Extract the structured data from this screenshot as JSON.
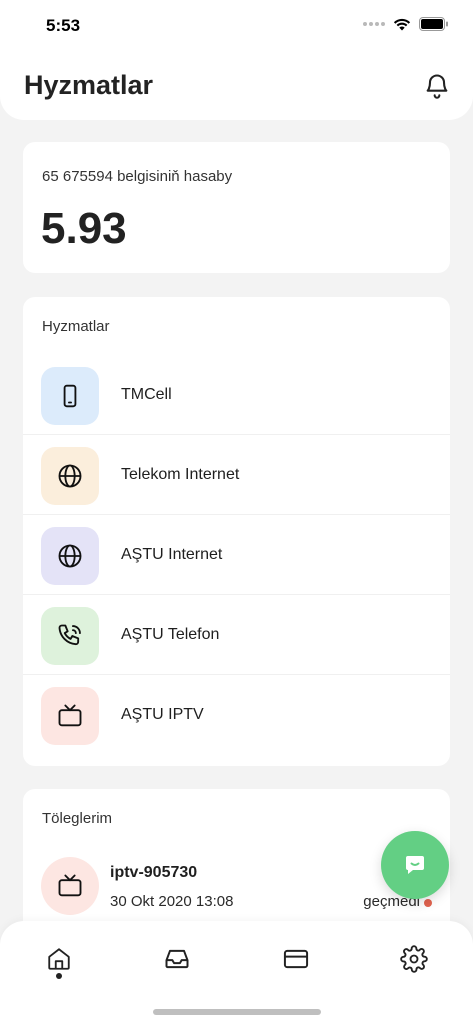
{
  "status_bar": {
    "time": "5:53"
  },
  "header": {
    "title": "Hyzmatlar",
    "bell_icon": "bell-icon"
  },
  "balance": {
    "label": "65 675594 belgisiniň hasaby",
    "value": "5.93"
  },
  "services": {
    "title": "Hyzmatlar",
    "items": [
      {
        "label": "TMCell",
        "icon": "phone-icon",
        "color": "#dcebfb"
      },
      {
        "label": "Telekom Internet",
        "icon": "globe-icon",
        "color": "#fbeedc"
      },
      {
        "label": "AŞTU Internet",
        "icon": "globe-icon",
        "color": "#e4e3f7"
      },
      {
        "label": "AŞTU Telefon",
        "icon": "phone-call-icon",
        "color": "#def2dc"
      },
      {
        "label": "AŞTU IPTV",
        "icon": "tv-icon",
        "color": "#fde6e2"
      }
    ]
  },
  "payments": {
    "title": "Töleglerim",
    "items": [
      {
        "id": "iptv-905730",
        "date": "30 Okt 2020 13:08",
        "status": "geçmedi",
        "status_color": "#e2634f",
        "icon": "tv-icon"
      }
    ]
  },
  "fab": {
    "icon": "chat-icon",
    "color": "#63cf84"
  },
  "tabbar": {
    "tabs": [
      "home-icon",
      "inbox-icon",
      "card-icon",
      "settings-icon"
    ],
    "active": 0
  }
}
